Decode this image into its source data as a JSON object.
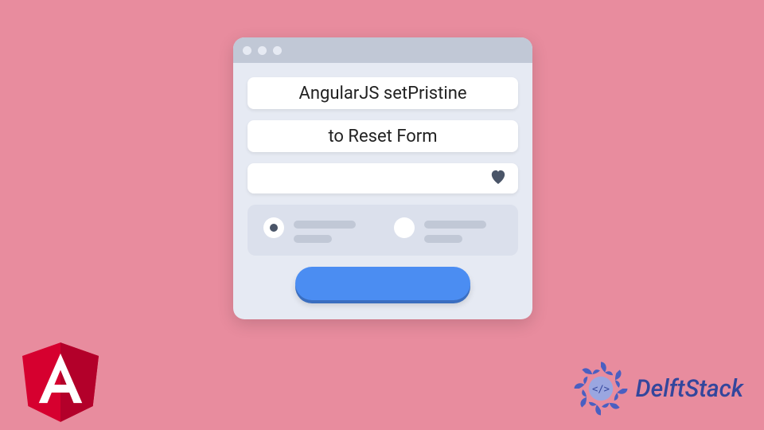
{
  "fields": {
    "line1": "AngularJS setPristine",
    "line2": "to Reset Form"
  },
  "brand": {
    "angular_letter": "A",
    "delft_name": "DelftStack"
  },
  "colors": {
    "bg": "#e88c9e",
    "window": "#e6eaf3",
    "titlebar": "#c1c8d6",
    "button": "#4b8df2",
    "brand_blue": "#33469c",
    "angular_red": "#d6002f"
  }
}
